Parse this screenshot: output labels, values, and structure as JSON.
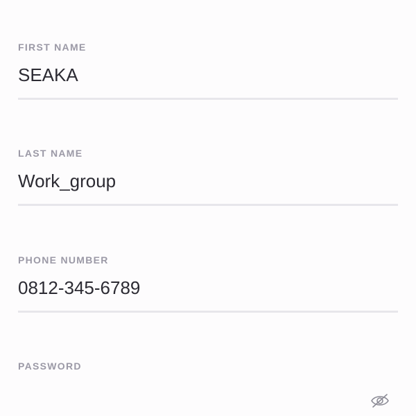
{
  "form": {
    "first_name": {
      "label": "FIRST NAME",
      "value": "SEAKA"
    },
    "last_name": {
      "label": "LAST NAME",
      "value": "Work_group"
    },
    "phone_number": {
      "label": "PHONE NUMBER",
      "value": "0812-345-6789"
    },
    "password": {
      "label": "PASSWORD",
      "value": "",
      "visibility_icon": "eye-off-icon"
    }
  },
  "colors": {
    "background": "#fdfcfd",
    "label": "#9b99a6",
    "value": "#2c2b33",
    "underline": "#e7e6eb",
    "icon": "#8c8b96"
  }
}
